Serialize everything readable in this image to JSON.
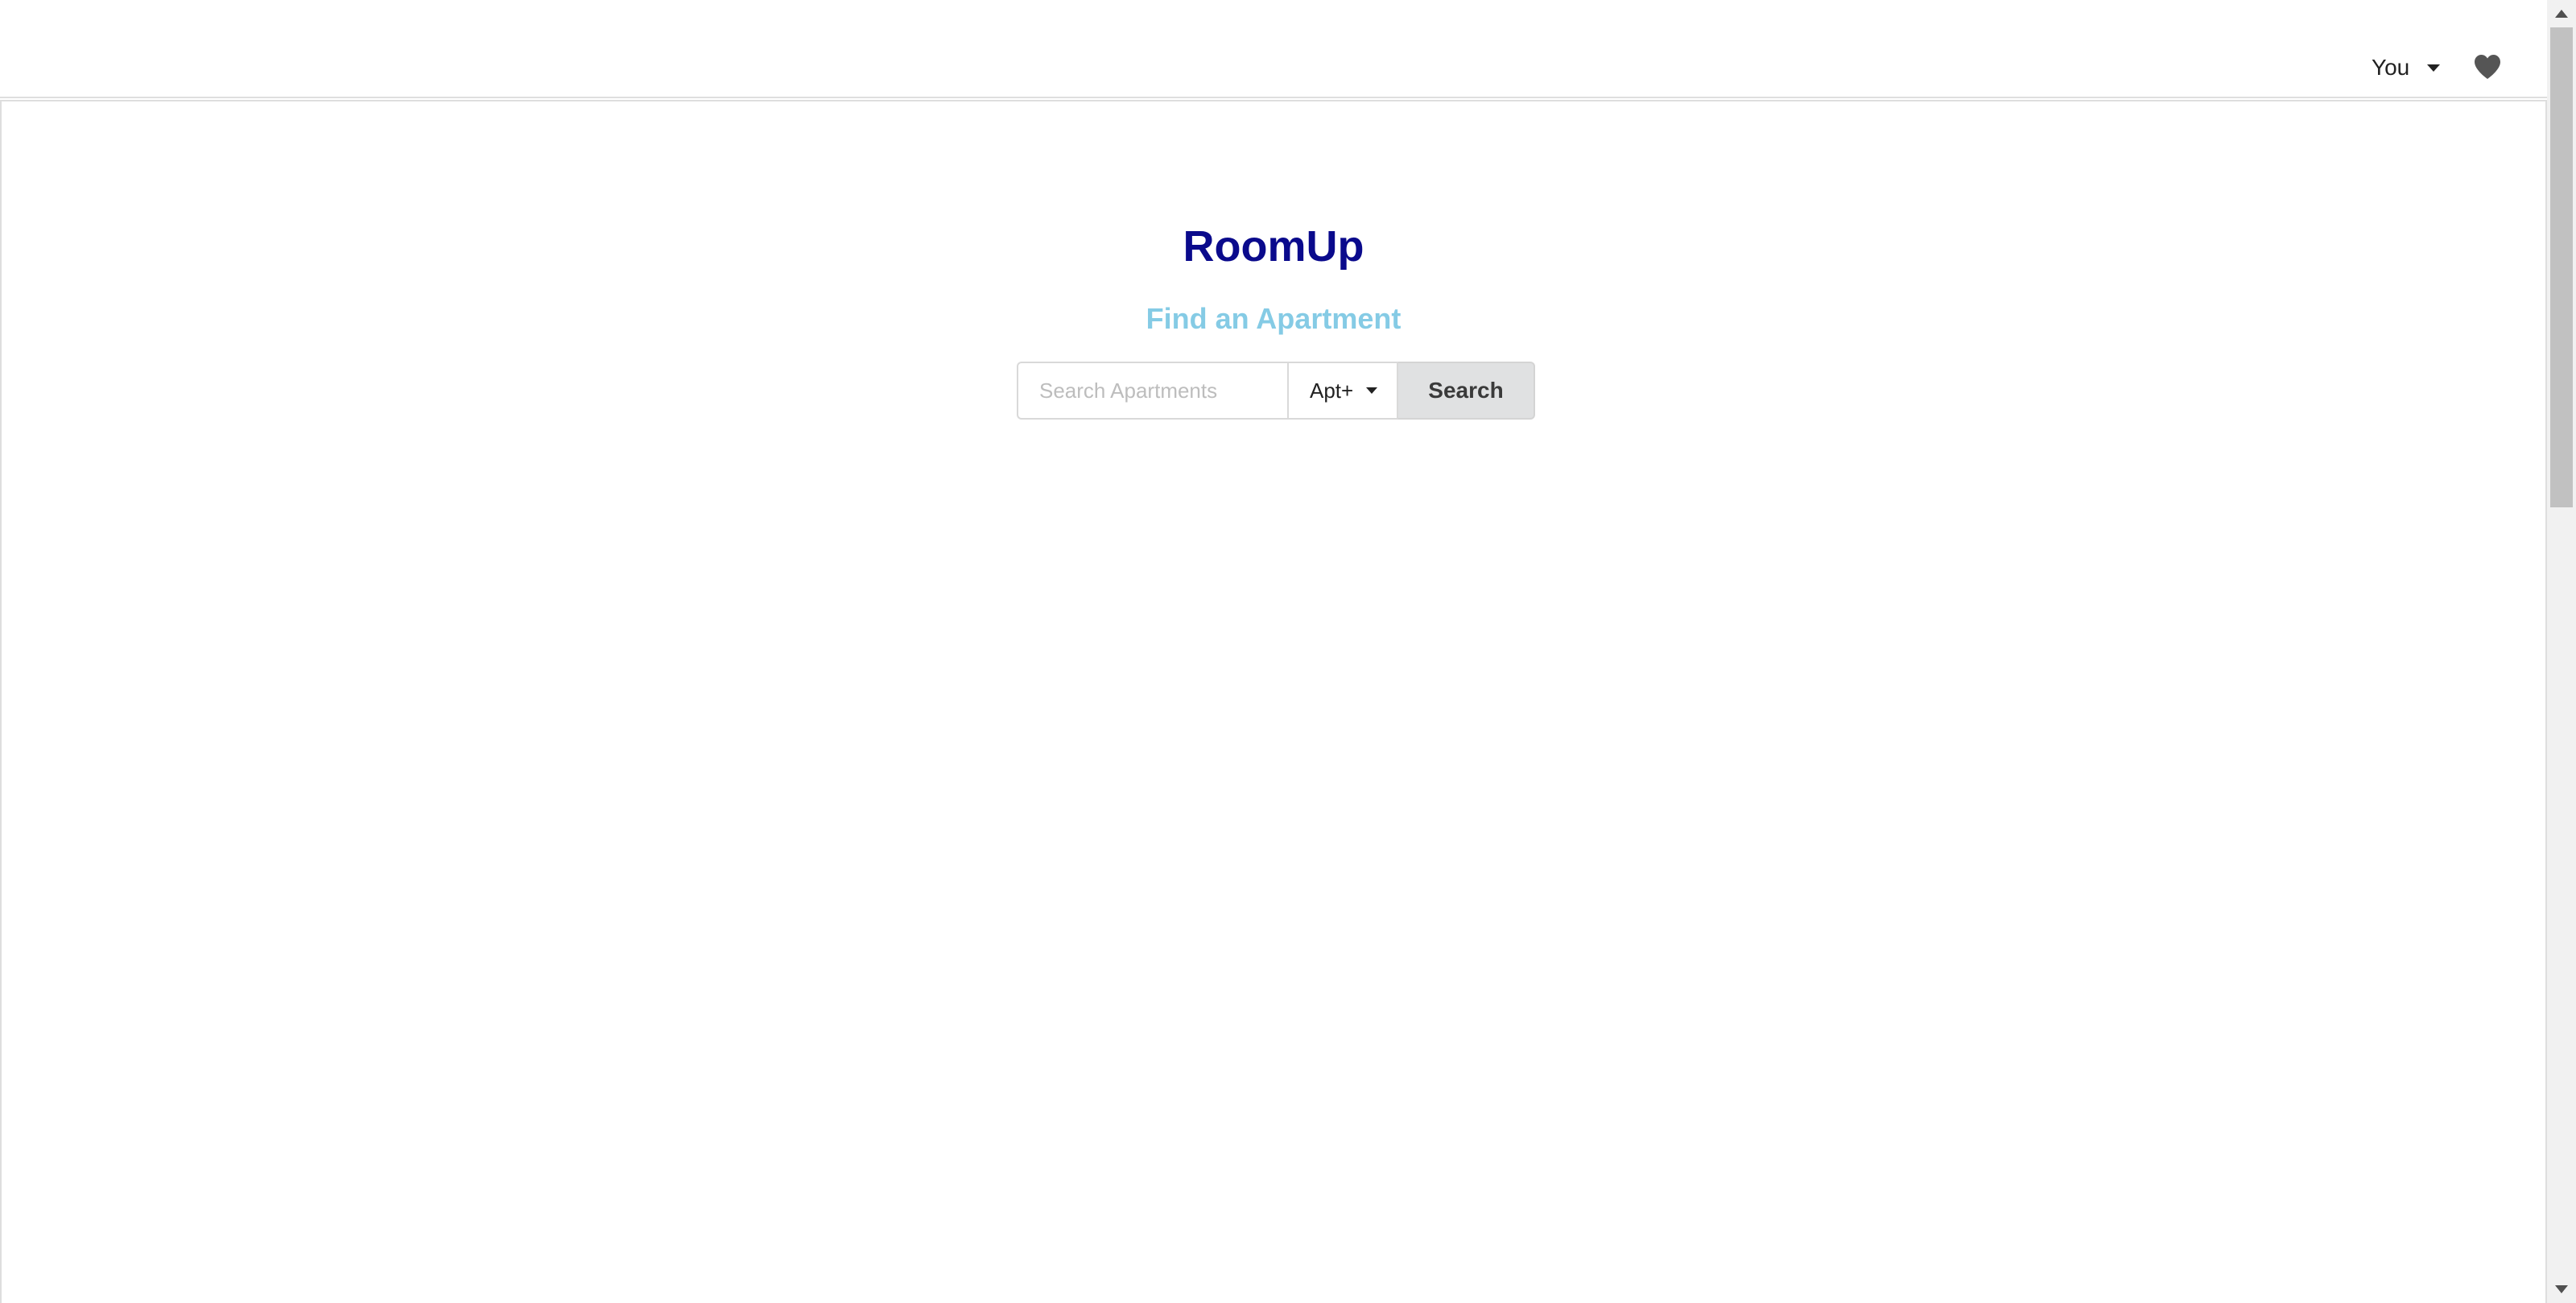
{
  "header": {
    "user_label": "You",
    "favorites_icon": "heart-icon"
  },
  "hero": {
    "brand": "RoomUp",
    "subtitle": "Find an Apartment"
  },
  "search": {
    "placeholder": "Search Apartments",
    "value": "",
    "type_selected": "Apt+",
    "button_label": "Search"
  },
  "colors": {
    "brand": "#0a0a8c",
    "subtitle": "#85cbe5",
    "button_bg": "#e0e1e2"
  }
}
